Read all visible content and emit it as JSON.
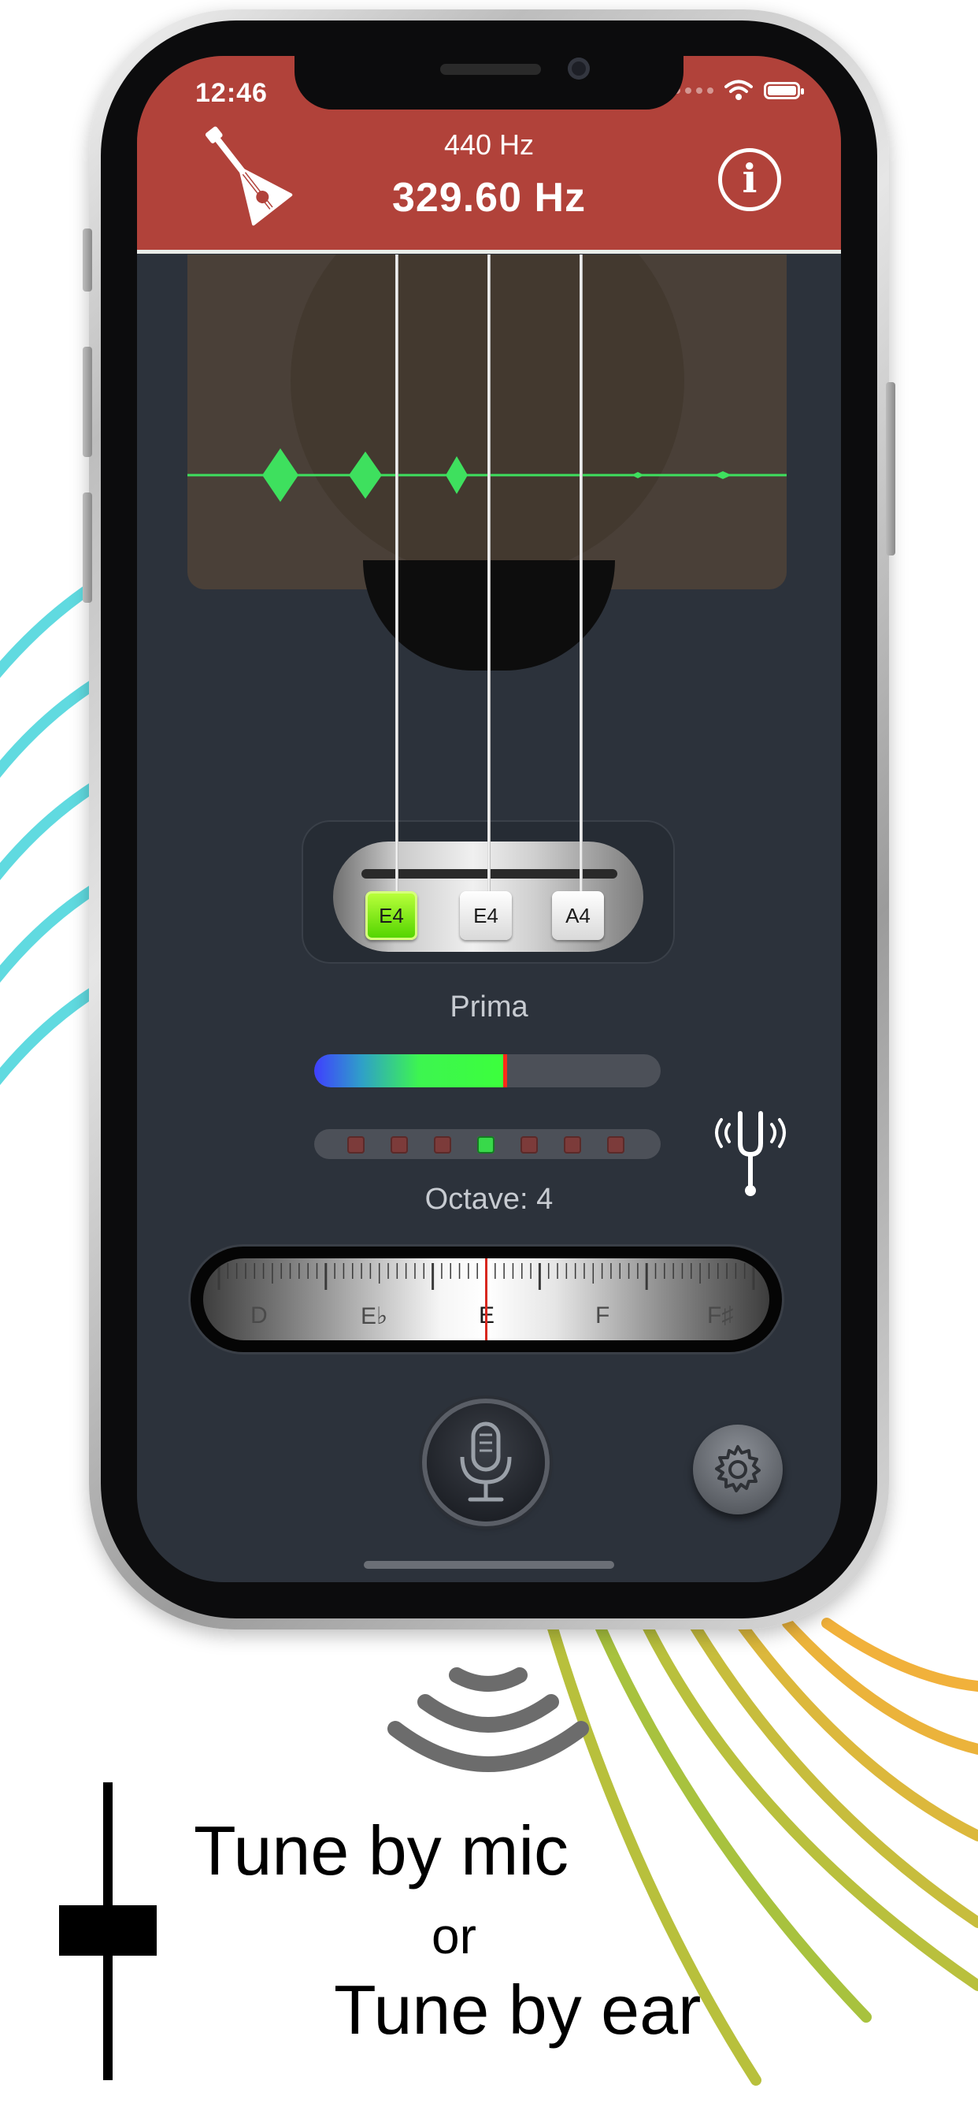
{
  "status_bar": {
    "time": "12:46"
  },
  "header": {
    "reference_frequency": "440 Hz",
    "current_frequency": "329.60 Hz",
    "info_glyph": "i",
    "logo_icon": "balalaika-icon"
  },
  "strings": [
    {
      "note": "E4",
      "selected": true
    },
    {
      "note": "E4",
      "selected": false
    },
    {
      "note": "A4",
      "selected": false
    }
  ],
  "tuner": {
    "string_name": "Prima",
    "signal_level": 0.55,
    "led_count": 7,
    "led_active_index": 3,
    "octave_label": "Octave: 4",
    "scale_notes": [
      "D",
      "E♭",
      "E",
      "F",
      "F♯"
    ],
    "scale_active_note": "E"
  },
  "controls": {
    "mic_icon": "microphone-icon",
    "settings_icon": "gear-icon",
    "tuning_fork_icon": "tuning-fork-icon"
  },
  "promo": {
    "line1": "Tune by mic",
    "line2": "or",
    "line3": "Tune by ear",
    "wave_icon": "sound-waves-icon"
  },
  "colors": {
    "header": "#b1423a",
    "screen_bg": "#2c323b",
    "active_green": "#3cff3c",
    "needle_red": "#d8281f",
    "arc_cyan": "#4fd6dd",
    "arc_orange": "#f1b13b",
    "arc_olive": "#a8c23e"
  }
}
